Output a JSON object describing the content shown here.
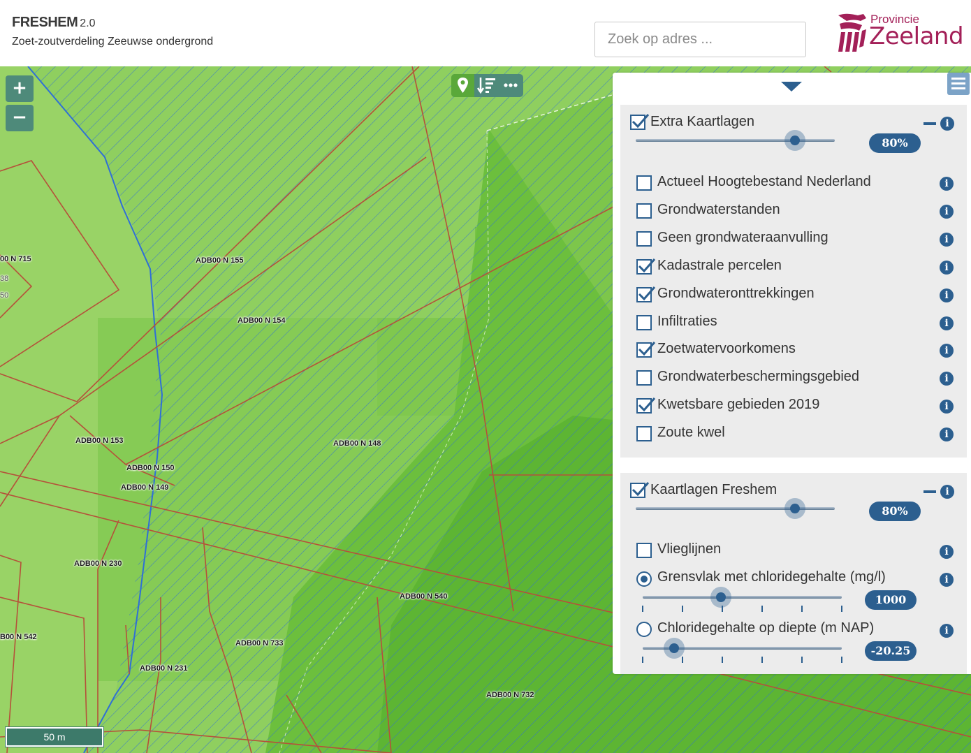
{
  "header": {
    "title": "FRESHEM",
    "version": "2.0",
    "subtitle": "Zoet-zoutverdeling Zeeuwse ondergrond",
    "search_placeholder": "Zoek op adres ...",
    "logo_top": "Provincie",
    "logo_main": "Zeeland"
  },
  "map": {
    "zoom_in": "+",
    "zoom_out": "−",
    "scale_label": "50 m",
    "toolbar_icons": [
      "location-pin-icon",
      "sort-down-icon",
      "more-dots-icon"
    ],
    "parcel_labels": [
      "00 N 715",
      "ADB00 N 155",
      "ADB00 N 154",
      "ADB00 N 153",
      "ADB00 N 150",
      "ADB00 N 149",
      "ADB00 N 148",
      "ADB00 N 230",
      "ADB00 N 540",
      "B00 N 542",
      "ADB00 N 733",
      "ADB00 N 231",
      "ADB00 N 732",
      "38",
      "50"
    ],
    "colors": {
      "light_green": "#8fcf5f",
      "mid_green": "#6cbf3d",
      "dark_green": "#4eaa2a",
      "hatch_blue": "#2f6fd6",
      "parcel_line": "#b5513a"
    }
  },
  "panel": {
    "groups": [
      {
        "title": "Extra Kaartlagen",
        "checked": true,
        "opacity_label": "80%",
        "opacity": 0.8,
        "layers": [
          {
            "label": "Actueel Hoogtebestand Nederland",
            "checked": false
          },
          {
            "label": "Grondwaterstanden",
            "checked": false
          },
          {
            "label": "Geen grondwateraanvulling",
            "checked": false
          },
          {
            "label": "Kadastrale percelen",
            "checked": true
          },
          {
            "label": "Grondwateronttrekkingen",
            "checked": true
          },
          {
            "label": "Infiltraties",
            "checked": false
          },
          {
            "label": "Zoetwatervoorkomens",
            "checked": true
          },
          {
            "label": "Grondwaterbeschermingsgebied",
            "checked": false
          },
          {
            "label": "Kwetsbare gebieden 2019",
            "checked": true
          },
          {
            "label": "Zoute kwel",
            "checked": false
          }
        ]
      },
      {
        "title": "Kaartlagen Freshem",
        "checked": true,
        "opacity_label": "80%",
        "opacity": 0.8,
        "layers": [
          {
            "label": "Vlieglijnen",
            "type": "checkbox",
            "checked": false
          },
          {
            "label": "Grensvlak met chloridegehalte (mg/l)",
            "type": "radio",
            "checked": true,
            "value_label": "1000"
          },
          {
            "label": "Chloridegehalte op diepte (m NAP)",
            "type": "radio",
            "checked": false,
            "value_label": "-20.25"
          }
        ]
      }
    ],
    "info_icon": "i",
    "accent_color": "#2c5f8f"
  }
}
